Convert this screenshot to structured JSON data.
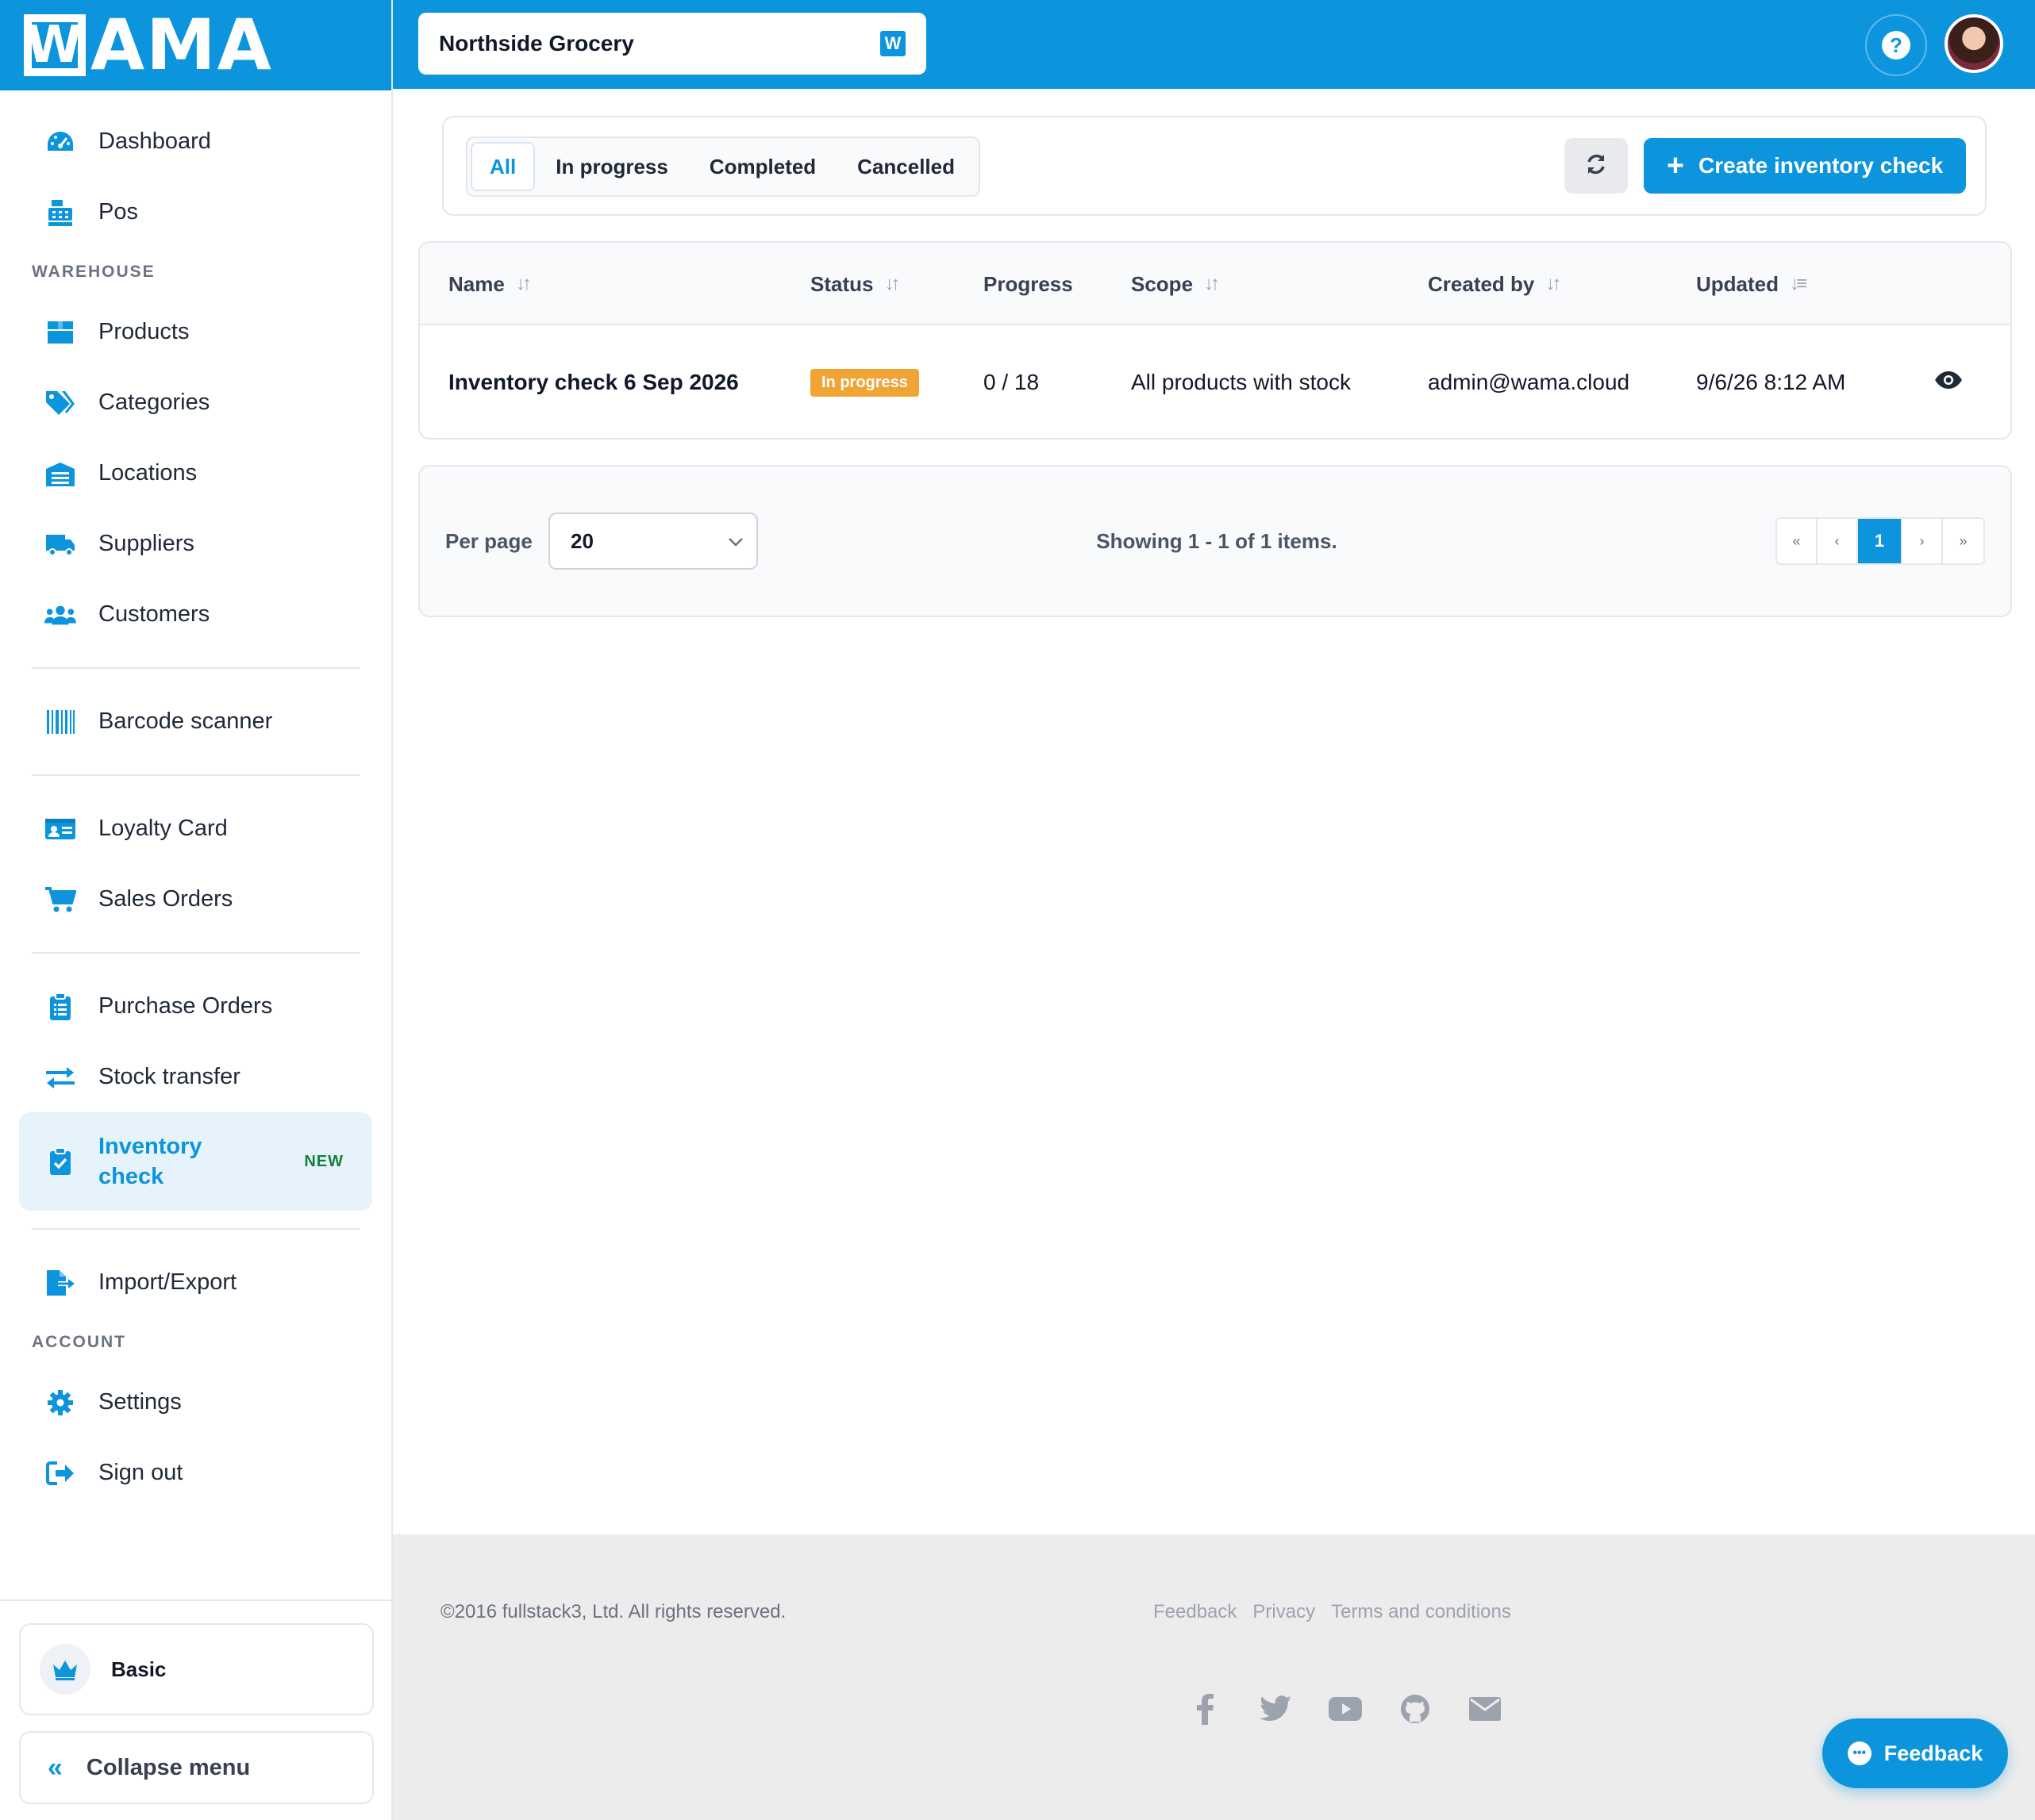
{
  "brand": {
    "logo_text": "WAMA",
    "accent": "#0c95dd"
  },
  "topbar": {
    "store_name": "Northside Grocery",
    "help_icon": "question-circle-icon",
    "avatar": "user-avatar"
  },
  "sidebar": {
    "items_top": [
      {
        "label": "Dashboard",
        "icon": "dashboard-icon"
      },
      {
        "label": "Pos",
        "icon": "cash-register-icon"
      }
    ],
    "section_warehouse": "WAREHOUSE",
    "items_warehouse": [
      {
        "label": "Products",
        "icon": "box-icon"
      },
      {
        "label": "Categories",
        "icon": "tags-icon"
      },
      {
        "label": "Locations",
        "icon": "warehouse-icon"
      },
      {
        "label": "Suppliers",
        "icon": "truck-icon"
      },
      {
        "label": "Customers",
        "icon": "users-icon"
      }
    ],
    "barcode": {
      "label": "Barcode scanner",
      "icon": "barcode-icon"
    },
    "items_sales": [
      {
        "label": "Loyalty Card",
        "icon": "id-card-icon"
      },
      {
        "label": "Sales Orders",
        "icon": "cart-icon"
      }
    ],
    "items_purchase": [
      {
        "label": "Purchase Orders",
        "icon": "clipboard-list-icon"
      },
      {
        "label": "Stock transfer",
        "icon": "exchange-icon"
      }
    ],
    "active_item": {
      "label": "Inventory check",
      "badge": "NEW",
      "icon": "clipboard-check-icon"
    },
    "import_export": {
      "label": "Import/Export",
      "icon": "file-export-icon"
    },
    "section_account": "ACCOUNT",
    "items_account": [
      {
        "label": "Settings",
        "icon": "gear-icon"
      },
      {
        "label": "Sign out",
        "icon": "sign-out-icon"
      }
    ],
    "plan": {
      "label": "Basic",
      "icon": "crown-icon"
    },
    "collapse": {
      "label": "Collapse menu",
      "icon": "double-chevron-left-icon"
    }
  },
  "filters": {
    "tabs": [
      "All",
      "In progress",
      "Completed",
      "Cancelled"
    ],
    "active_tab": "All",
    "refresh_icon": "refresh-icon",
    "create_label": "Create inventory check"
  },
  "table": {
    "columns": [
      "Name",
      "Status",
      "Progress",
      "Scope",
      "Created by",
      "Updated"
    ],
    "rows": [
      {
        "name": "Inventory check 6 Sep 2026",
        "status": "In progress",
        "progress": "0 / 18",
        "scope": "All products with stock",
        "created_by": "admin@wama.cloud",
        "updated": "9/6/26 8:12 AM",
        "action_icon": "eye-icon"
      }
    ]
  },
  "pagination": {
    "per_page_label": "Per page",
    "per_page_value": "20",
    "showing": "Showing 1 - 1 of 1 items.",
    "first": "«",
    "prev": "‹",
    "current": "1",
    "next": "›",
    "last": "»"
  },
  "footer": {
    "copyright": "©2016 fullstack3, Ltd. All rights reserved.",
    "links": [
      "Feedback",
      "Privacy",
      "Terms and conditions"
    ],
    "social_icons": [
      "facebook-icon",
      "twitter-icon",
      "youtube-icon",
      "github-icon",
      "envelope-icon"
    ]
  },
  "feedback_button": {
    "label": "Feedback"
  }
}
